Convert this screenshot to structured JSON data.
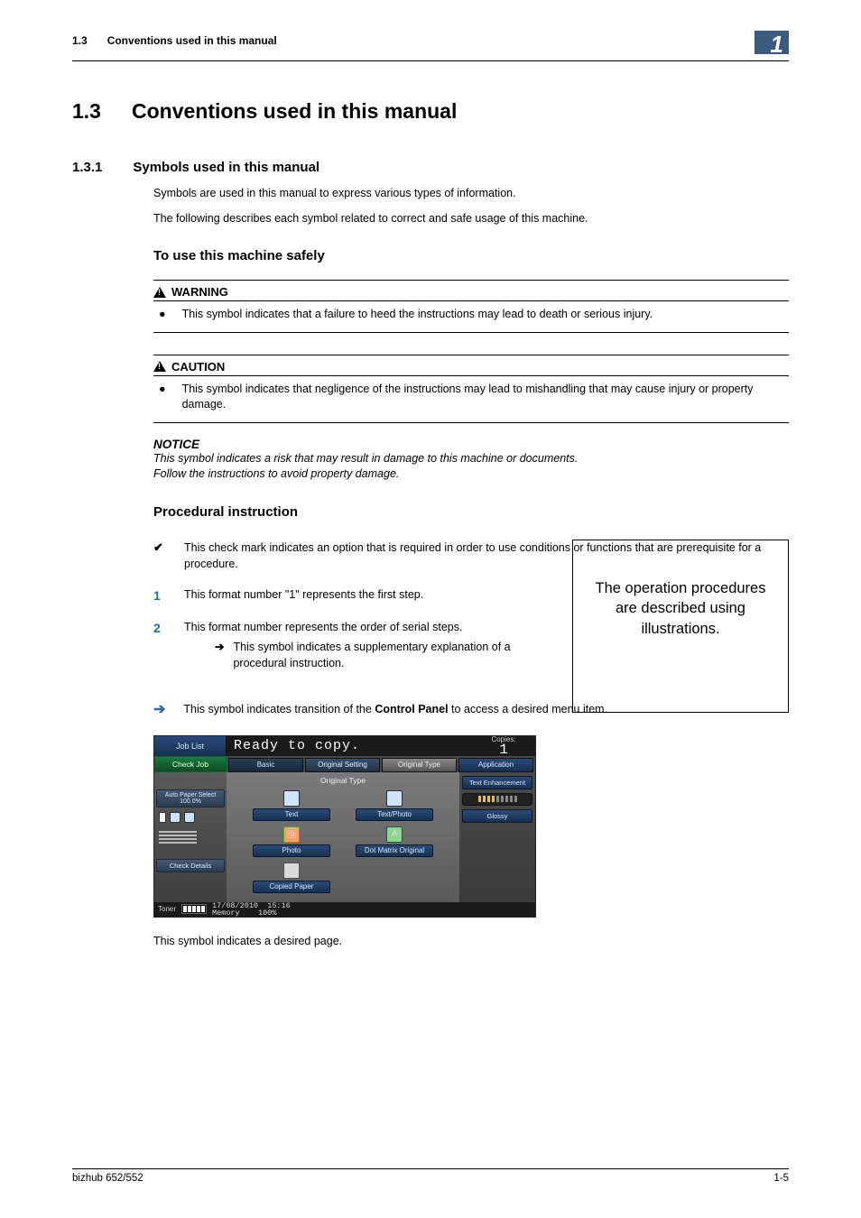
{
  "running_header": {
    "sec": "1.3",
    "title": "Conventions used in this manual"
  },
  "chapter_tab": "1",
  "h1": {
    "num": "1.3",
    "title": "Conventions used in this manual"
  },
  "h2": {
    "num": "1.3.1",
    "title": "Symbols used in this manual"
  },
  "intro1": "Symbols are used in this manual to express various types of information.",
  "intro2": "The following describes each symbol related to correct and safe usage of this machine.",
  "h3_safe": "To use this machine safely",
  "warning": {
    "label": "WARNING",
    "bullet": "This symbol indicates that a failure to heed the instructions may lead to death or serious injury."
  },
  "caution": {
    "label": "CAUTION",
    "bullet": "This symbol indicates that negligence of the instructions may lead to mishandling that may cause injury or property damage."
  },
  "notice": {
    "label": "NOTICE",
    "line1": "This symbol indicates a risk that may result in damage to this machine or documents.",
    "line2": "Follow the instructions to avoid property damage."
  },
  "h3_proc": "Procedural instruction",
  "proc_check": "This check mark indicates an option that is required in order to use conditions or functions that are prerequisite for a procedure.",
  "proc_1": {
    "num": "1",
    "text": "This format number \"1\" represents the first step."
  },
  "proc_2": {
    "num": "2",
    "text": "This format number represents the order of serial steps.",
    "sub": "This symbol indicates a supplementary explanation of a procedural instruction."
  },
  "callout": "The operation procedures are described using illustrations.",
  "arrow_line_a": "This symbol indicates transition of the ",
  "arrow_line_bold": "Control Panel",
  "arrow_line_b": " to access a desired menu item.",
  "panel": {
    "job_list": "Job List",
    "ready": "Ready to copy.",
    "copies_label": "Copies:",
    "copies_value": "1",
    "check_job": "Check Job",
    "tabs": {
      "basic": "Basic",
      "orig_set": "Original Setting",
      "orig_type": "Original Type",
      "app": "Application"
    },
    "left": {
      "auto_paper": "Auto Paper Select  100.0%",
      "check_details": "Check Details"
    },
    "center": {
      "header": "Original Type",
      "text": "Text",
      "text_photo": "Text/Photo",
      "photo": "Photo",
      "dotmatrix": "Dot Matrix Original",
      "copied": "Copied Paper"
    },
    "right": {
      "text_enh": "Text Enhancement",
      "glossy": "Glossy"
    },
    "bottom": {
      "toner": "Toner",
      "date": "17/08/2010",
      "time": "15:16",
      "memory_label": "Memory",
      "memory": "100%"
    }
  },
  "desired_page": "This symbol indicates a desired page.",
  "footer": {
    "left": "bizhub 652/552",
    "right": "1-5"
  }
}
